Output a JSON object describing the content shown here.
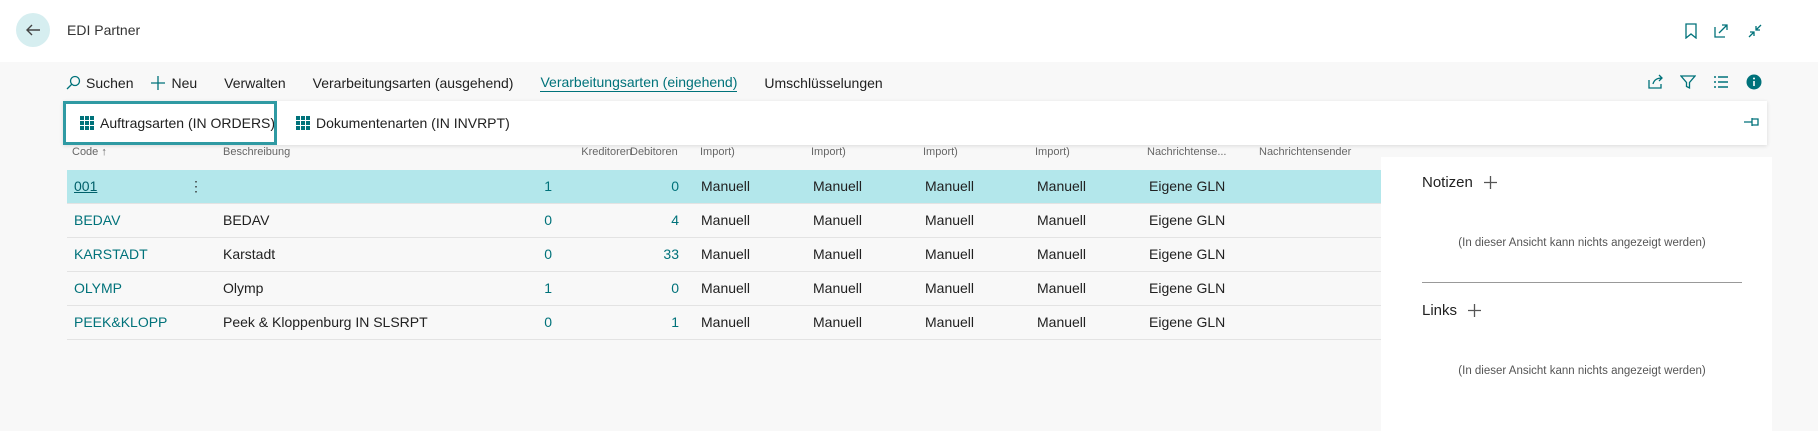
{
  "header": {
    "title": "EDI Partner"
  },
  "toolbar": {
    "search": "Suchen",
    "new": "Neu",
    "manage": "Verwalten",
    "outgoing": "Verarbeitungsarten (ausgehend)",
    "incoming": "Verarbeitungsarten (eingehend)",
    "mappings": "Umschlüsselungen"
  },
  "subactions": {
    "orders": "Auftragsarten (IN ORDERS)",
    "invrpt": "Dokumentenarten (IN INVRPT)"
  },
  "columns": {
    "code": "Code ↑",
    "desc": "Beschreibung",
    "kred": "Kreditoren",
    "deb": "Debitoren",
    "imp1": "Import)",
    "imp2": "Import)",
    "imp3": "Import)",
    "imp4": "Import)",
    "nachr1": "Nachrichtense...",
    "nachr2": "Nachrichtensender"
  },
  "rows": [
    {
      "code": "001",
      "desc": "",
      "kred": "1",
      "deb": "0",
      "imp1": "Manuell",
      "imp2": "Manuell",
      "imp3": "Manuell",
      "imp4": "Manuell",
      "nachr": "Eigene GLN"
    },
    {
      "code": "BEDAV",
      "desc": "BEDAV",
      "kred": "0",
      "deb": "4",
      "imp1": "Manuell",
      "imp2": "Manuell",
      "imp3": "Manuell",
      "imp4": "Manuell",
      "nachr": "Eigene GLN"
    },
    {
      "code": "KARSTADT",
      "desc": "Karstadt",
      "kred": "0",
      "deb": "33",
      "imp1": "Manuell",
      "imp2": "Manuell",
      "imp3": "Manuell",
      "imp4": "Manuell",
      "nachr": "Eigene GLN"
    },
    {
      "code": "OLYMP",
      "desc": "Olymp",
      "kred": "1",
      "deb": "0",
      "imp1": "Manuell",
      "imp2": "Manuell",
      "imp3": "Manuell",
      "imp4": "Manuell",
      "nachr": "Eigene GLN"
    },
    {
      "code": "PEEK&KLOPP",
      "desc": "Peek & Kloppenburg IN SLSRPT",
      "kred": "0",
      "deb": "1",
      "imp1": "Manuell",
      "imp2": "Manuell",
      "imp3": "Manuell",
      "imp4": "Manuell",
      "nachr": "Eigene GLN"
    }
  ],
  "factbox": {
    "notes_title": "Notizen",
    "notes_empty": "(In dieser Ansicht kann nichts angezeigt werden)",
    "links_title": "Links",
    "links_empty": "(In dieser Ansicht kann nichts angezeigt werden)"
  },
  "colors": {
    "accent": "#00727a",
    "selected_row": "#b3e7eb"
  }
}
